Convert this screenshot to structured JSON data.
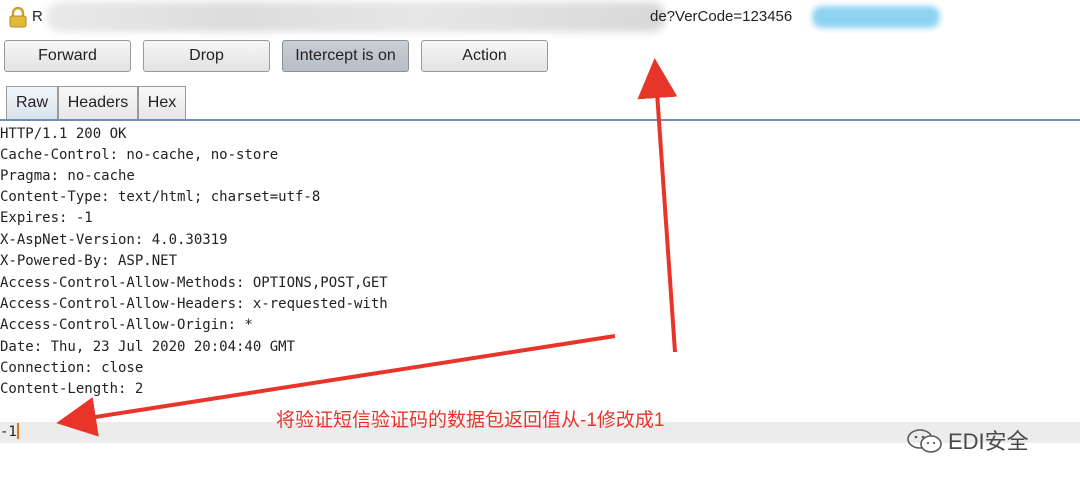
{
  "url_bar": {
    "prefix": "R",
    "visible_tail": "de?VerCode=123456"
  },
  "toolbar": {
    "forward": "Forward",
    "drop": "Drop",
    "intercept": "Intercept is on",
    "action": "Action"
  },
  "tabs": [
    "Raw",
    "Headers",
    "Hex"
  ],
  "response": {
    "lines": [
      "HTTP/1.1 200 OK",
      "Cache-Control: no-cache, no-store",
      "Pragma: no-cache",
      "Content-Type: text/html; charset=utf-8",
      "Expires: -1",
      "X-AspNet-Version: 4.0.30319",
      "X-Powered-By: ASP.NET",
      "Access-Control-Allow-Methods: OPTIONS,POST,GET",
      "Access-Control-Allow-Headers: x-requested-with",
      "Access-Control-Allow-Origin: *",
      "Date: Thu, 23 Jul 2020 20:04:40 GMT",
      "Connection: close",
      "Content-Length: 2",
      "",
      "-1"
    ]
  },
  "annotation": {
    "text": "将验证短信验证码的数据包返回值从-1修改成1",
    "color": "#e8352a"
  },
  "watermark": {
    "text": "EDI安全"
  },
  "colors": {
    "accent_tab_line": "#6e8fb2",
    "caret": "#e0761c"
  }
}
